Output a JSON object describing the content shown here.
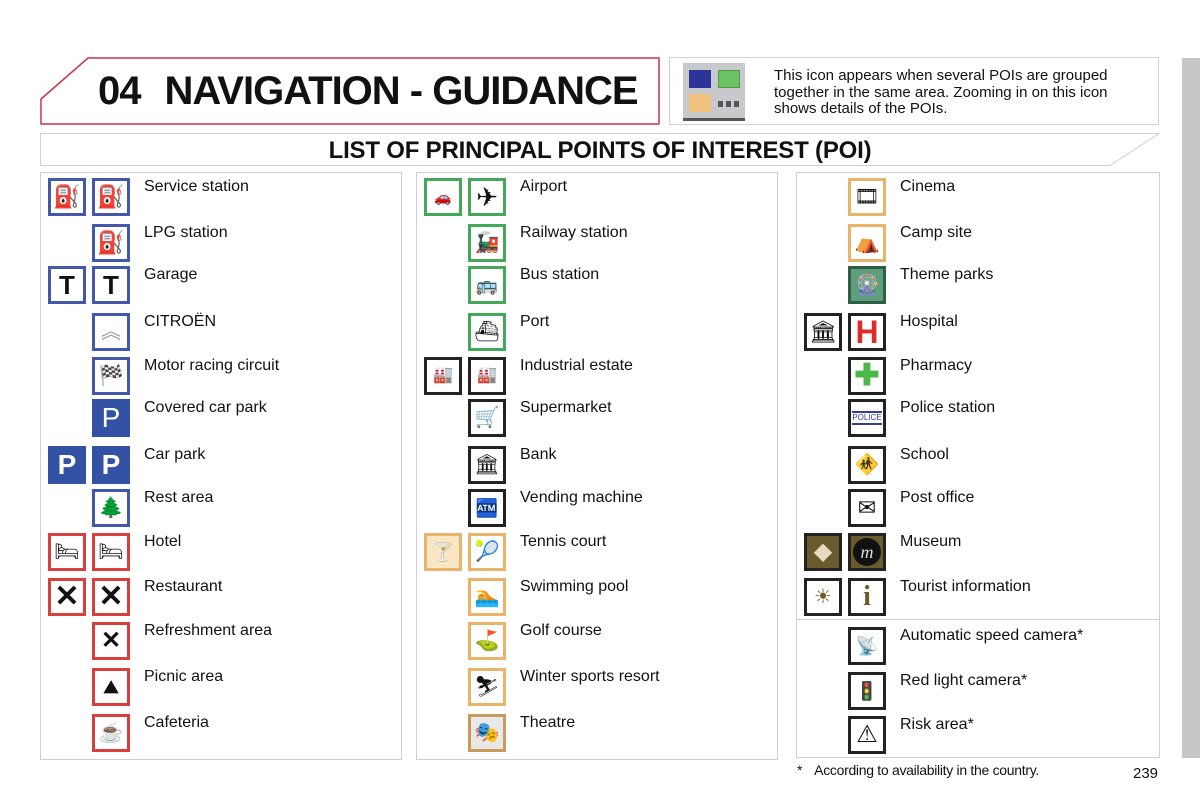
{
  "header": {
    "chapter_number": "04",
    "chapter_title": "NAVIGATION - GUIDANCE",
    "accent_color": "#c8334b"
  },
  "cluster_info": {
    "icon": "grouped-poi-icon",
    "colors": [
      "#2d3497",
      "#6cc165",
      "#f2c27f"
    ],
    "text": "This icon appears when several POIs are grouped together in the same area. Zooming in on this icon shows details of the POIs."
  },
  "section_title": "LIST OF PRINCIPAL POINTS OF INTEREST (POI)",
  "columns": [
    {
      "items": [
        {
          "label": "Service station",
          "icons": [
            "fuel-pump-icon",
            "fuel-pump-icon"
          ]
        },
        {
          "label": "LPG station",
          "icons": [
            "lpg-pump-icon"
          ]
        },
        {
          "label": "Garage",
          "icons": [
            "wrench-icon",
            "wrench-icon"
          ]
        },
        {
          "label": "CITROËN",
          "icons": [
            "citroen-logo-icon"
          ]
        },
        {
          "label": "Motor racing circuit",
          "icons": [
            "racing-circuit-icon"
          ]
        },
        {
          "label": "Covered car park",
          "icons": [
            "covered-parking-icon"
          ]
        },
        {
          "label": "Car park",
          "icons": [
            "parking-icon",
            "parking-icon"
          ]
        },
        {
          "label": "Rest area",
          "icons": [
            "rest-area-icon"
          ]
        },
        {
          "label": "Hotel",
          "icons": [
            "bed-icon",
            "bed-icon"
          ]
        },
        {
          "label": "Restaurant",
          "icons": [
            "fork-spoon-icon",
            "fork-spoon-icon"
          ]
        },
        {
          "label": "Refreshment area",
          "icons": [
            "refreshment-icon"
          ]
        },
        {
          "label": "Picnic area",
          "icons": [
            "picnic-table-icon"
          ]
        },
        {
          "label": "Cafeteria",
          "icons": [
            "coffee-cup-icon"
          ]
        }
      ]
    },
    {
      "items": [
        {
          "label": "Airport",
          "icons": [
            "transport-group-icon",
            "airplane-icon"
          ]
        },
        {
          "label": "Railway station",
          "icons": [
            "train-icon"
          ]
        },
        {
          "label": "Bus station",
          "icons": [
            "bus-icon"
          ]
        },
        {
          "label": "Port",
          "icons": [
            "ship-icon"
          ]
        },
        {
          "label": "Industrial estate",
          "icons": [
            "industry-group-icon",
            "industry-group-icon"
          ]
        },
        {
          "label": "Supermarket",
          "icons": [
            "shopping-cart-icon"
          ]
        },
        {
          "label": "Bank",
          "icons": [
            "bank-icon"
          ]
        },
        {
          "label": "Vending machine",
          "icons": [
            "atm-icon"
          ]
        },
        {
          "label": "Tennis court",
          "icons": [
            "leisure-group-icon",
            "tennis-player-icon"
          ]
        },
        {
          "label": "Swimming pool",
          "icons": [
            "swimmer-icon"
          ]
        },
        {
          "label": "Golf course",
          "icons": [
            "golfer-icon"
          ]
        },
        {
          "label": "Winter sports resort",
          "icons": [
            "skier-icon"
          ]
        },
        {
          "label": "Theatre",
          "icons": [
            "theatre-icon"
          ]
        }
      ]
    },
    {
      "items": [
        {
          "label": "Cinema",
          "icons": [
            "film-icon"
          ]
        },
        {
          "label": "Camp site",
          "icons": [
            "tent-caravan-icon"
          ]
        },
        {
          "label": "Theme parks",
          "icons": [
            "ferris-wheel-icon"
          ]
        },
        {
          "label": "Hospital",
          "icons": [
            "public-building-icon",
            "hospital-h-icon"
          ]
        },
        {
          "label": "Pharmacy",
          "icons": [
            "green-cross-icon"
          ]
        },
        {
          "label": "Police station",
          "icons": [
            "police-icon"
          ]
        },
        {
          "label": "School",
          "icons": [
            "children-icon"
          ]
        },
        {
          "label": "Post office",
          "icons": [
            "envelope-icon"
          ]
        },
        {
          "label": "Museum",
          "icons": [
            "monument-icon",
            "museum-m-icon"
          ]
        },
        {
          "label": "Tourist information",
          "icons": [
            "tourism-icon",
            "info-i-icon"
          ]
        },
        {
          "label": "Automatic speed camera*",
          "icons": [
            "speed-camera-icon"
          ]
        },
        {
          "label": "Red light camera*",
          "icons": [
            "red-light-camera-icon"
          ]
        },
        {
          "label": "Risk area*",
          "icons": [
            "risk-area-icon"
          ]
        }
      ]
    }
  ],
  "footnote": {
    "marker": "*",
    "text": "According to availability in the country."
  },
  "page_number": "239"
}
